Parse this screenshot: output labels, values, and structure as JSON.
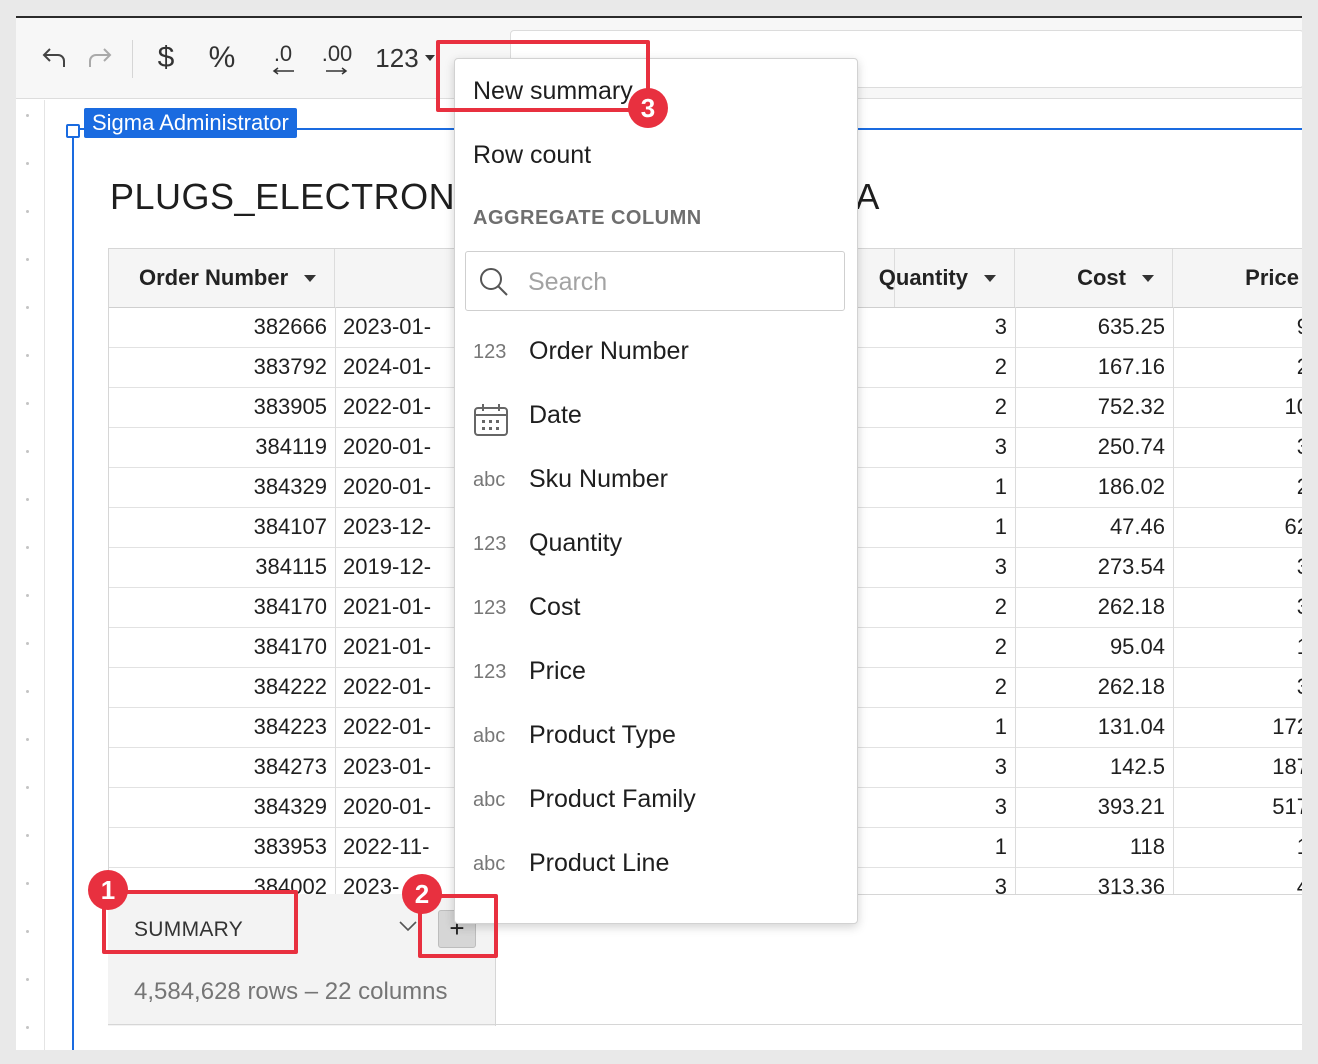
{
  "toolbar": {
    "currency_symbol": "$",
    "percent_symbol": "%",
    "decrease_decimals": ".0",
    "increase_decimals": ".00",
    "number_format": "123"
  },
  "user_badge": "Sigma Administrator",
  "title": {
    "visible_start": "PLUGS_ELECTRONI",
    "visible_end": "TA"
  },
  "table": {
    "columns": [
      "Order Number",
      "Quantity",
      "Cost",
      "Price"
    ],
    "rows": [
      {
        "order": "382666",
        "date": "2023-01-",
        "qty": "3",
        "cost": "635.25",
        "price": "9"
      },
      {
        "order": "383792",
        "date": "2024-01-",
        "qty": "2",
        "cost": "167.16",
        "price": "2"
      },
      {
        "order": "383905",
        "date": "2022-01-",
        "qty": "2",
        "cost": "752.32",
        "price": "10"
      },
      {
        "order": "384119",
        "date": "2020-01-",
        "qty": "3",
        "cost": "250.74",
        "price": "3"
      },
      {
        "order": "384329",
        "date": "2020-01-",
        "qty": "1",
        "cost": "186.02",
        "price": "2"
      },
      {
        "order": "384107",
        "date": "2023-12-",
        "qty": "1",
        "cost": "47.46",
        "price": "62"
      },
      {
        "order": "384115",
        "date": "2019-12-",
        "qty": "3",
        "cost": "273.54",
        "price": "3"
      },
      {
        "order": "384170",
        "date": "2021-01-",
        "qty": "2",
        "cost": "262.18",
        "price": "3"
      },
      {
        "order": "384170",
        "date": "2021-01-",
        "qty": "2",
        "cost": "95.04",
        "price": "1"
      },
      {
        "order": "384222",
        "date": "2022-01-",
        "qty": "2",
        "cost": "262.18",
        "price": "3"
      },
      {
        "order": "384223",
        "date": "2022-01-",
        "qty": "1",
        "cost": "131.04",
        "price": "172"
      },
      {
        "order": "384273",
        "date": "2023-01-",
        "qty": "3",
        "cost": "142.5",
        "price": "187"
      },
      {
        "order": "384329",
        "date": "2020-01-",
        "qty": "3",
        "cost": "393.21",
        "price": "517"
      },
      {
        "order": "383953",
        "date": "2022-11-",
        "qty": "1",
        "cost": "118",
        "price": "1"
      },
      {
        "order": "384002",
        "date": "2023-",
        "qty": "3",
        "cost": "313.36",
        "price": "4"
      }
    ]
  },
  "summary": {
    "label": "SUMMARY",
    "add_symbol": "+",
    "row_info": "4,584,628 rows – 22 columns"
  },
  "dropdown": {
    "new_summary": "New summary",
    "row_count": "Row count",
    "section_title": "AGGREGATE COLUMN",
    "search_placeholder": "Search",
    "columns": [
      {
        "type": "123",
        "label": "Order Number"
      },
      {
        "type": "calendar-icon",
        "label": "Date"
      },
      {
        "type": "abc",
        "label": "Sku Number"
      },
      {
        "type": "123",
        "label": "Quantity"
      },
      {
        "type": "123",
        "label": "Cost"
      },
      {
        "type": "123",
        "label": "Price"
      },
      {
        "type": "abc",
        "label": "Product Type"
      },
      {
        "type": "abc",
        "label": "Product Family"
      },
      {
        "type": "abc",
        "label": "Product Line"
      }
    ]
  },
  "callouts": [
    "1",
    "2",
    "3"
  ],
  "colors": {
    "accent_blue": "#1a6be0",
    "callout_red": "#e8303f"
  }
}
